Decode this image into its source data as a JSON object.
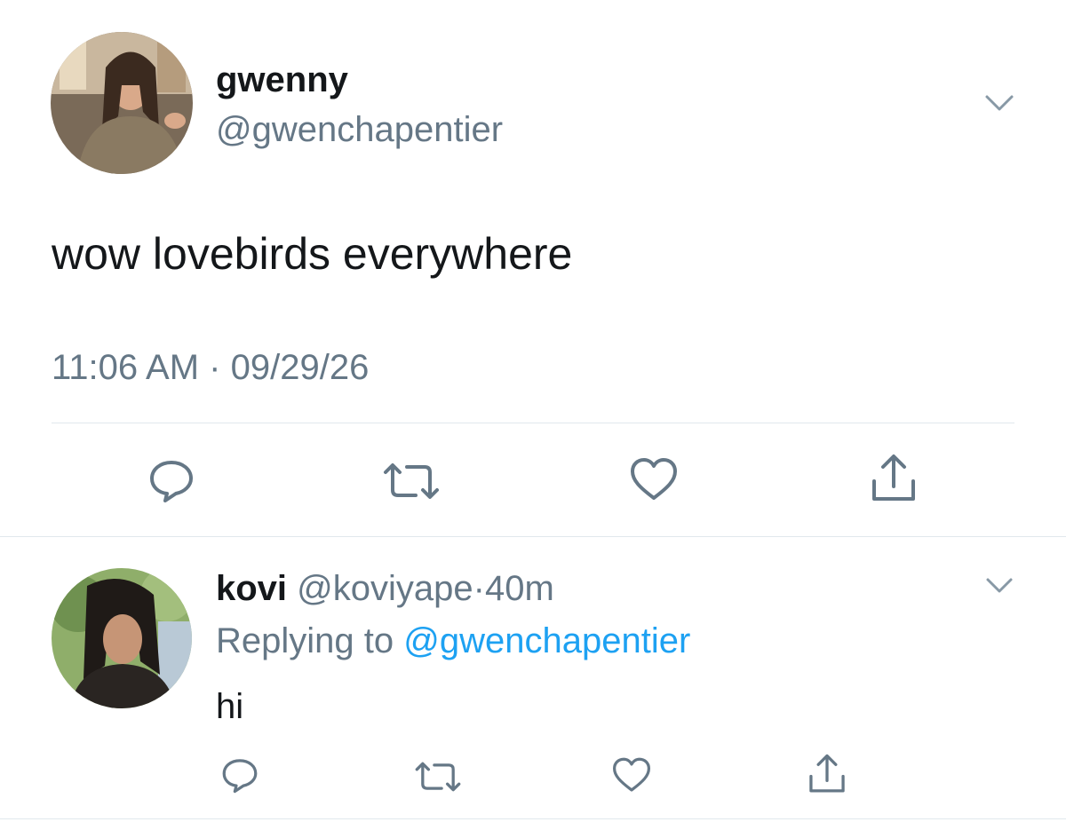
{
  "main_tweet": {
    "author_name": "gwenny",
    "handle": "@gwenchapentier",
    "text": "wow lovebirds everywhere",
    "time": "11:06 AM",
    "separator": "·",
    "date": "09/29/26"
  },
  "reply": {
    "author_name": "kovi",
    "handle": "@koviyape",
    "separator": "·",
    "age": "40m",
    "replying_prefix": "Replying to",
    "replying_handle": "@gwenchapentier",
    "text": "hi"
  },
  "icons": {
    "reply": "speech-bubble-icon",
    "retweet": "retweet-icon",
    "like": "heart-icon",
    "share": "share-icon",
    "menu": "chevron-down-icon"
  },
  "colors": {
    "text": "#14171a",
    "muted": "#657786",
    "link": "#1da1f2",
    "divider": "#e1e8ed"
  }
}
